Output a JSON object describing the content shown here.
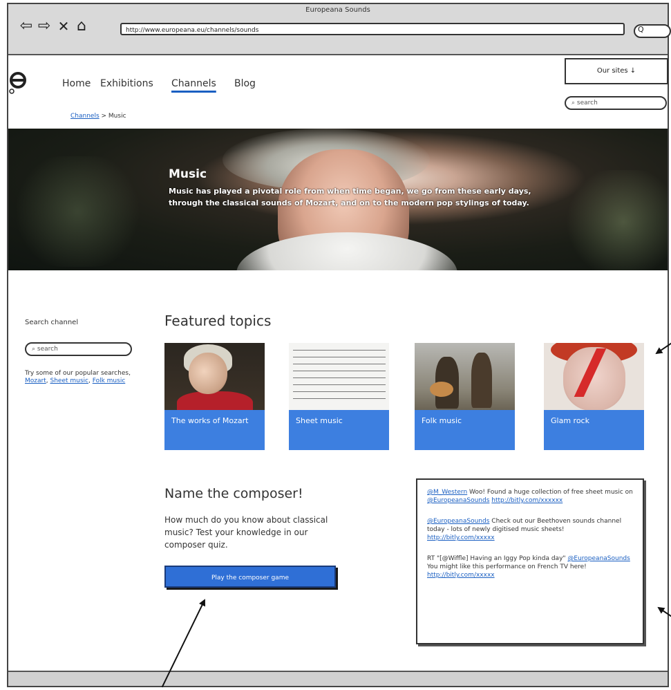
{
  "browser": {
    "window_title": "Europeana Sounds",
    "url": "http://www.europeana.eu/channels/sounds",
    "nav_icons": [
      "back-arrow-icon",
      "forward-arrow-icon",
      "stop-icon",
      "home-icon"
    ],
    "search_glyph": "Q"
  },
  "header": {
    "nav": [
      "Home",
      "Exhibitions",
      "Channels",
      "Blog"
    ],
    "active_nav": "Channels",
    "our_sites": "Our sites ↓",
    "search_placeholder": "search"
  },
  "breadcrumb": {
    "parent": "Channels",
    "separator": " > ",
    "current": "Music"
  },
  "hero": {
    "title": "Music",
    "description": "Music has played a pivotal role from when time began, we go from these early days, through the classical sounds of Mozart, and on to the modern pop stylings of today."
  },
  "sidebar": {
    "label": "Search channel",
    "search_placeholder": "search",
    "hint_prefix": "Try some of our popular searches,",
    "popular": [
      "Mozart",
      "Sheet music",
      "Folk music"
    ]
  },
  "featured": {
    "title": "Featured topics",
    "topics": [
      "The works of Mozart",
      "Sheet music",
      "Folk music",
      "Glam rock"
    ]
  },
  "quiz": {
    "title": "Name the composer!",
    "text": "How much do you know about classical music? Test your knowledge in our composer quiz.",
    "button": "Play the composer game"
  },
  "tweets": [
    {
      "handle": "@M_Western",
      "text": " Woo! Found a huge collection of free sheet music on ",
      "mention": "@EuropeanaSounds",
      "link": "http://bitly.com/xxxxxx"
    },
    {
      "handle": "@EuropeanaSounds",
      "text": " Check out our Beethoven sounds channel today - lots of newly digitised music sheets! ",
      "mention": "",
      "link": "http://bitly.com/xxxxx"
    },
    {
      "handle": "",
      "text": "RT \"[@Wiffle] Having an Iggy Pop kinda day\" ",
      "mention": "@EuropeanaSounds",
      "text2": " You might like this performance on French TV here! ",
      "link": "http://bitly.com/xxxxx"
    }
  ],
  "colors": {
    "accent": "#3d7fe0",
    "button": "#2f6fd6",
    "link": "#1a5fc2"
  }
}
